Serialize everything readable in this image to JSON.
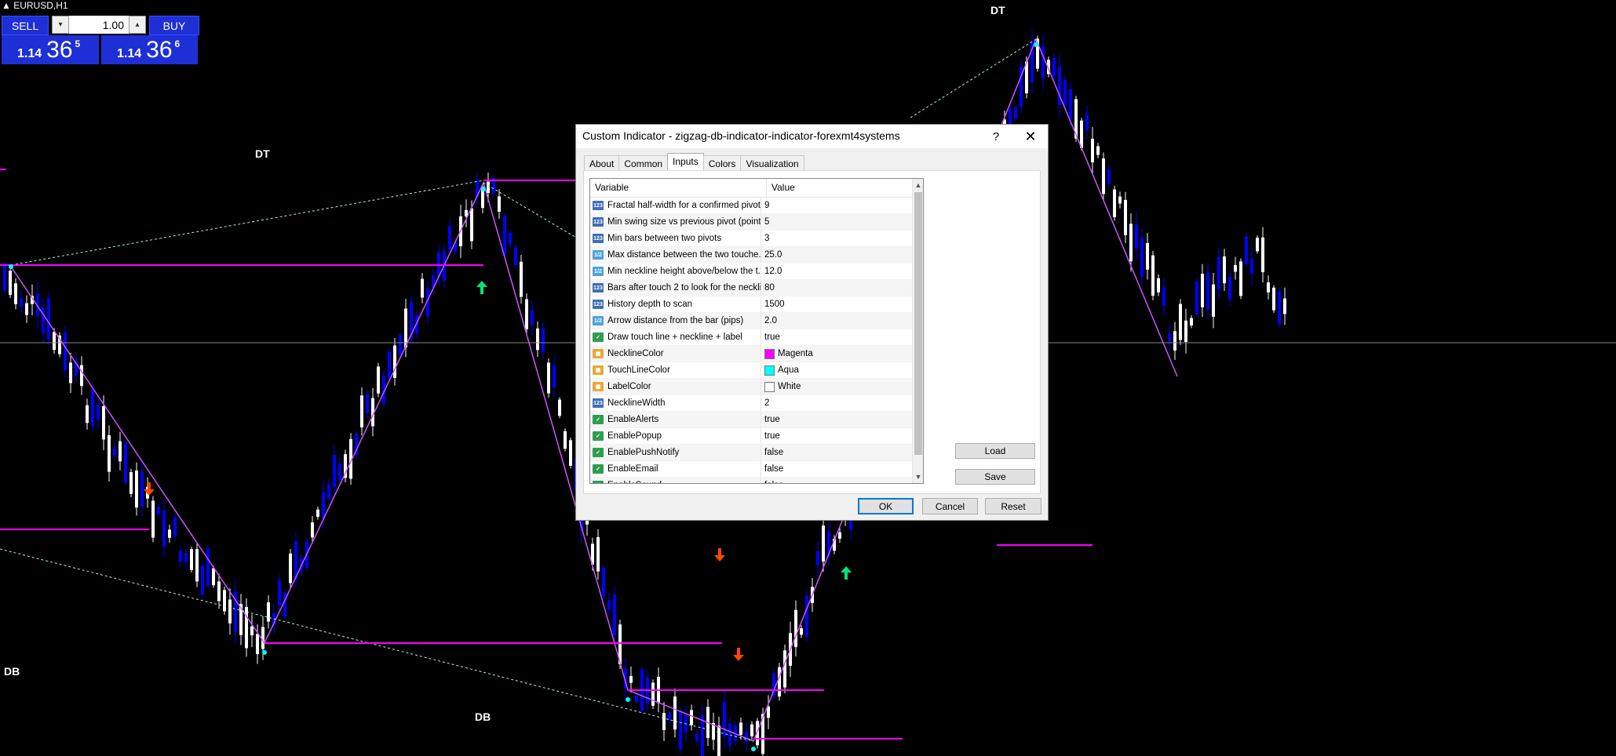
{
  "chart": {
    "symbol": "EURUSD,H1",
    "labels": [
      "DT",
      "DT",
      "DB",
      "DB"
    ],
    "colors": {
      "neckline": "#ff00ff",
      "touchline": "#00ffff",
      "zigzag": "#cc55ff",
      "bull": "#ffffff",
      "bear": "#0000ff",
      "up_arrow": "#00e676",
      "down_arrow": "#ff4500"
    }
  },
  "trade_panel": {
    "sell_label": "SELL",
    "buy_label": "BUY",
    "lot": "1.00",
    "down_arrow": "▾",
    "up_arrow": "▴",
    "bid": {
      "small": "1.14",
      "big": "36",
      "sup": "5"
    },
    "ask": {
      "small": "1.14",
      "big": "36",
      "sup": "6"
    }
  },
  "dialog": {
    "title": "Custom Indicator - zigzag-db-indicator-indicator-forexmt4systems",
    "help": "?",
    "close": "✕",
    "tabs": [
      "About",
      "Common",
      "Inputs",
      "Colors",
      "Visualization"
    ],
    "active_tab": "Inputs",
    "grid": {
      "col_variable": "Variable",
      "col_value": "Value",
      "rows": [
        {
          "type": "int",
          "variable": "Fractal half-width for a confirmed pivot",
          "value": "9"
        },
        {
          "type": "int",
          "variable": "Min swing size vs previous pivot (points)",
          "value": "5"
        },
        {
          "type": "int",
          "variable": "Min bars between two pivots",
          "value": "3"
        },
        {
          "type": "double",
          "variable": "Max distance between the two touche...",
          "value": "25.0"
        },
        {
          "type": "double",
          "variable": "Min neckline height above/below the t...",
          "value": "12.0"
        },
        {
          "type": "int",
          "variable": "Bars after touch 2 to look for the neckli...",
          "value": "80"
        },
        {
          "type": "int",
          "variable": "History depth to scan",
          "value": "1500"
        },
        {
          "type": "double",
          "variable": "Arrow distance from the bar (pips)",
          "value": "2.0"
        },
        {
          "type": "bool",
          "variable": "Draw touch line + neckline + label",
          "value": "true"
        },
        {
          "type": "color",
          "variable": "NecklineColor",
          "value": "Magenta",
          "swatch": "#ff00ff"
        },
        {
          "type": "color",
          "variable": "TouchLineColor",
          "value": "Aqua",
          "swatch": "#00ffff"
        },
        {
          "type": "color",
          "variable": "LabelColor",
          "value": "White",
          "swatch": "#ffffff"
        },
        {
          "type": "int",
          "variable": "NecklineWidth",
          "value": "2"
        },
        {
          "type": "bool",
          "variable": "EnableAlerts",
          "value": "true"
        },
        {
          "type": "bool",
          "variable": "EnablePopup",
          "value": "true"
        },
        {
          "type": "bool",
          "variable": "EnablePushNotify",
          "value": "false"
        },
        {
          "type": "bool",
          "variable": "EnableEmail",
          "value": "false"
        },
        {
          "type": "bool",
          "variable": "EnableSound",
          "value": "false"
        }
      ]
    },
    "buttons": {
      "load": "Load",
      "save": "Save",
      "ok": "OK",
      "cancel": "Cancel",
      "reset": "Reset"
    }
  }
}
